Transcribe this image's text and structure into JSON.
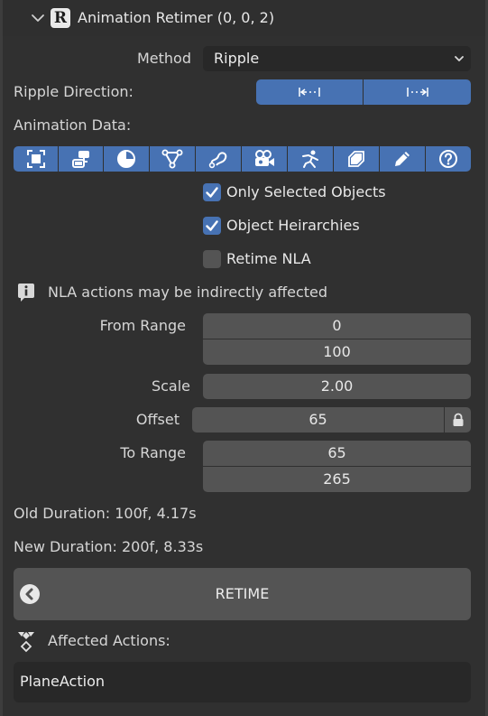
{
  "header": {
    "title": "Animation Retimer (0, 0, 2)",
    "logo_letter": "R"
  },
  "method": {
    "label": "Method",
    "value": "Ripple"
  },
  "ripple_direction": {
    "label": "Ripple Direction:",
    "options": [
      {
        "icon": "ripple-left-icon",
        "glyph": "|←··|"
      },
      {
        "icon": "ripple-right-icon",
        "glyph": "|··→|"
      }
    ]
  },
  "animation_data": {
    "label": "Animation Data:",
    "icons": [
      "object-icon",
      "armature-data-icon",
      "material-icon",
      "node-tree-icon",
      "curve-icon",
      "camera-icon",
      "pose-icon",
      "shape-key-icon",
      "grease-pencil-icon",
      "help-icon"
    ]
  },
  "options": {
    "only_selected": {
      "label": "Only Selected Objects",
      "checked": true
    },
    "object_hierarchies": {
      "label": "Object Heirarchies",
      "checked": true
    },
    "retime_nla": {
      "label": "Retime NLA",
      "checked": false
    }
  },
  "info": {
    "message": "NLA actions may be indirectly affected"
  },
  "from_range": {
    "label": "From Range",
    "start": "0",
    "end": "100"
  },
  "scale": {
    "label": "Scale",
    "value": "2.00"
  },
  "offset": {
    "label": "Offset",
    "value": "65"
  },
  "to_range": {
    "label": "To Range",
    "start": "65",
    "end": "265"
  },
  "durations": {
    "old": "Old Duration: 100f, 4.17s",
    "new": "New Duration: 200f, 8.33s"
  },
  "retime_button": {
    "label": "RETIME"
  },
  "affected": {
    "label": "Affected Actions:",
    "items": [
      "PlaneAction"
    ]
  },
  "colors": {
    "accent": "#4772b3",
    "panel": "#303030",
    "field": "#545454",
    "dark_field": "#282828"
  }
}
